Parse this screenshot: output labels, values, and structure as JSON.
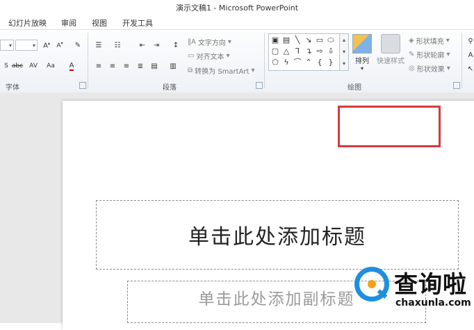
{
  "window": {
    "title": "演示文稿1 - Microsoft PowerPoint"
  },
  "tabs": [
    "幻灯片放映",
    "审阅",
    "视图",
    "开发工具"
  ],
  "ribbon": {
    "font_group": {
      "label": "字体",
      "clear_format_icon": "clear-format-icon"
    },
    "paragraph_group": {
      "label": "段落",
      "text_direction": "文字方向",
      "align_text": "对齐文本",
      "convert_smartart": "转换为 SmartArt"
    },
    "drawing_group": {
      "label": "绘图",
      "arrange": "排列",
      "quick_styles": "快速样式",
      "shape_fill": "形状填充",
      "shape_outline": "形状轮廓",
      "shape_effects": "形状效果"
    },
    "editing_group": {
      "find_glyph": "A"
    }
  },
  "slide": {
    "title_placeholder": "单击此处添加标题",
    "subtitle_placeholder": "单击此处添加副标题"
  },
  "watermark": {
    "name": "查询啦",
    "site": "chaxunla.com"
  },
  "colors": {
    "highlight": "#d6393d",
    "brand_blue": "#1e8fe0",
    "brand_orange": "#f3a31b"
  }
}
